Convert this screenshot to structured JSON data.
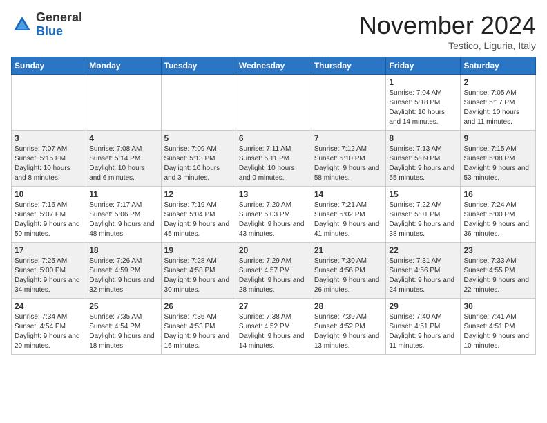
{
  "header": {
    "logo_general": "General",
    "logo_blue": "Blue",
    "month_title": "November 2024",
    "subtitle": "Testico, Liguria, Italy"
  },
  "weekdays": [
    "Sunday",
    "Monday",
    "Tuesday",
    "Wednesday",
    "Thursday",
    "Friday",
    "Saturday"
  ],
  "weeks": [
    [
      {
        "day": "",
        "info": ""
      },
      {
        "day": "",
        "info": ""
      },
      {
        "day": "",
        "info": ""
      },
      {
        "day": "",
        "info": ""
      },
      {
        "day": "",
        "info": ""
      },
      {
        "day": "1",
        "info": "Sunrise: 7:04 AM\nSunset: 5:18 PM\nDaylight: 10 hours and 14 minutes."
      },
      {
        "day": "2",
        "info": "Sunrise: 7:05 AM\nSunset: 5:17 PM\nDaylight: 10 hours and 11 minutes."
      }
    ],
    [
      {
        "day": "3",
        "info": "Sunrise: 7:07 AM\nSunset: 5:15 PM\nDaylight: 10 hours and 8 minutes."
      },
      {
        "day": "4",
        "info": "Sunrise: 7:08 AM\nSunset: 5:14 PM\nDaylight: 10 hours and 6 minutes."
      },
      {
        "day": "5",
        "info": "Sunrise: 7:09 AM\nSunset: 5:13 PM\nDaylight: 10 hours and 3 minutes."
      },
      {
        "day": "6",
        "info": "Sunrise: 7:11 AM\nSunset: 5:11 PM\nDaylight: 10 hours and 0 minutes."
      },
      {
        "day": "7",
        "info": "Sunrise: 7:12 AM\nSunset: 5:10 PM\nDaylight: 9 hours and 58 minutes."
      },
      {
        "day": "8",
        "info": "Sunrise: 7:13 AM\nSunset: 5:09 PM\nDaylight: 9 hours and 55 minutes."
      },
      {
        "day": "9",
        "info": "Sunrise: 7:15 AM\nSunset: 5:08 PM\nDaylight: 9 hours and 53 minutes."
      }
    ],
    [
      {
        "day": "10",
        "info": "Sunrise: 7:16 AM\nSunset: 5:07 PM\nDaylight: 9 hours and 50 minutes."
      },
      {
        "day": "11",
        "info": "Sunrise: 7:17 AM\nSunset: 5:06 PM\nDaylight: 9 hours and 48 minutes."
      },
      {
        "day": "12",
        "info": "Sunrise: 7:19 AM\nSunset: 5:04 PM\nDaylight: 9 hours and 45 minutes."
      },
      {
        "day": "13",
        "info": "Sunrise: 7:20 AM\nSunset: 5:03 PM\nDaylight: 9 hours and 43 minutes."
      },
      {
        "day": "14",
        "info": "Sunrise: 7:21 AM\nSunset: 5:02 PM\nDaylight: 9 hours and 41 minutes."
      },
      {
        "day": "15",
        "info": "Sunrise: 7:22 AM\nSunset: 5:01 PM\nDaylight: 9 hours and 38 minutes."
      },
      {
        "day": "16",
        "info": "Sunrise: 7:24 AM\nSunset: 5:00 PM\nDaylight: 9 hours and 36 minutes."
      }
    ],
    [
      {
        "day": "17",
        "info": "Sunrise: 7:25 AM\nSunset: 5:00 PM\nDaylight: 9 hours and 34 minutes."
      },
      {
        "day": "18",
        "info": "Sunrise: 7:26 AM\nSunset: 4:59 PM\nDaylight: 9 hours and 32 minutes."
      },
      {
        "day": "19",
        "info": "Sunrise: 7:28 AM\nSunset: 4:58 PM\nDaylight: 9 hours and 30 minutes."
      },
      {
        "day": "20",
        "info": "Sunrise: 7:29 AM\nSunset: 4:57 PM\nDaylight: 9 hours and 28 minutes."
      },
      {
        "day": "21",
        "info": "Sunrise: 7:30 AM\nSunset: 4:56 PM\nDaylight: 9 hours and 26 minutes."
      },
      {
        "day": "22",
        "info": "Sunrise: 7:31 AM\nSunset: 4:56 PM\nDaylight: 9 hours and 24 minutes."
      },
      {
        "day": "23",
        "info": "Sunrise: 7:33 AM\nSunset: 4:55 PM\nDaylight: 9 hours and 22 minutes."
      }
    ],
    [
      {
        "day": "24",
        "info": "Sunrise: 7:34 AM\nSunset: 4:54 PM\nDaylight: 9 hours and 20 minutes."
      },
      {
        "day": "25",
        "info": "Sunrise: 7:35 AM\nSunset: 4:54 PM\nDaylight: 9 hours and 18 minutes."
      },
      {
        "day": "26",
        "info": "Sunrise: 7:36 AM\nSunset: 4:53 PM\nDaylight: 9 hours and 16 minutes."
      },
      {
        "day": "27",
        "info": "Sunrise: 7:38 AM\nSunset: 4:52 PM\nDaylight: 9 hours and 14 minutes."
      },
      {
        "day": "28",
        "info": "Sunrise: 7:39 AM\nSunset: 4:52 PM\nDaylight: 9 hours and 13 minutes."
      },
      {
        "day": "29",
        "info": "Sunrise: 7:40 AM\nSunset: 4:51 PM\nDaylight: 9 hours and 11 minutes."
      },
      {
        "day": "30",
        "info": "Sunrise: 7:41 AM\nSunset: 4:51 PM\nDaylight: 9 hours and 10 minutes."
      }
    ]
  ]
}
